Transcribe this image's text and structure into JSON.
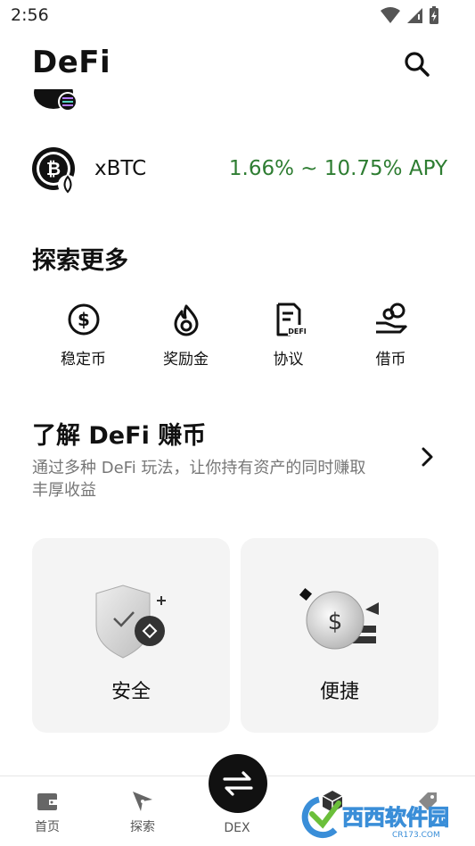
{
  "status_bar": {
    "time": "2:56"
  },
  "header": {
    "title": "DeFi"
  },
  "asset": {
    "name": "xBTC",
    "apy": "1.66% ~ 10.75% APY",
    "apy_color": "#2e7d32"
  },
  "explore": {
    "title": "探索更多",
    "items": [
      {
        "label": "稳定币",
        "icon": "dollar-coin-icon"
      },
      {
        "label": "奖励金",
        "icon": "flame-icon"
      },
      {
        "label": "协议",
        "icon": "defi-document-icon"
      },
      {
        "label": "借币",
        "icon": "hand-coins-icon"
      }
    ]
  },
  "learn": {
    "title": "了解 DeFi 赚币",
    "subtitle": "通过多种 DeFi 玩法，让你持有资产的同时赚取丰厚收益"
  },
  "features": [
    {
      "label": "安全",
      "icon": "shield-check-icon"
    },
    {
      "label": "便捷",
      "icon": "dollar-coin-stack-icon"
    }
  ],
  "tabs": [
    {
      "label": "首页",
      "icon": "wallet-icon"
    },
    {
      "label": "探索",
      "icon": "compass-icon"
    },
    {
      "label": "DEX",
      "icon": "swap-arrows-icon"
    },
    {
      "label": "",
      "icon": "cube-icon"
    },
    {
      "label": "",
      "icon": "tag-icon"
    }
  ],
  "watermark": {
    "text": "西西软件园",
    "sub": "CR173.COM"
  }
}
